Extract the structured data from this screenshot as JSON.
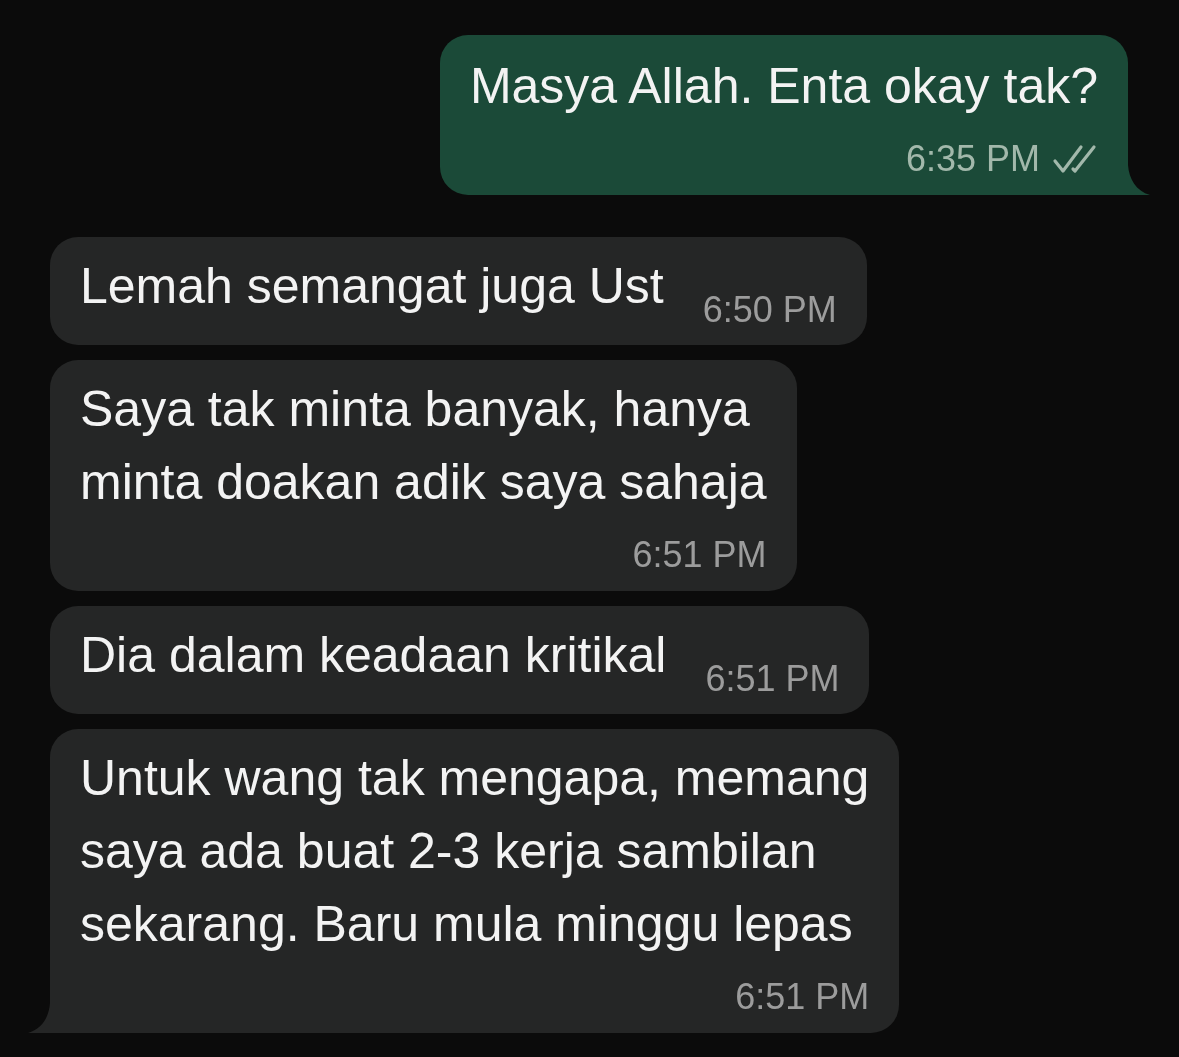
{
  "messages": [
    {
      "kind": "sent",
      "lines": [
        "Masya Allah. Enta okay tak?"
      ],
      "time": "6:35 PM",
      "read": false,
      "tail": true
    },
    {
      "kind": "received",
      "lines": [
        "Lemah semangat juga Ust"
      ],
      "time": "6:50 PM",
      "tail": false
    },
    {
      "kind": "received",
      "lines": [
        "Saya tak minta banyak, hanya",
        "minta doakan adik saya sahaja"
      ],
      "time": "6:51 PM",
      "tail": false
    },
    {
      "kind": "received",
      "lines": [
        "Dia dalam keadaan kritikal"
      ],
      "time": "6:51 PM",
      "tail": false
    },
    {
      "kind": "received",
      "lines": [
        "Untuk wang tak mengapa, memang",
        "saya ada buat 2-3 kerja sambilan",
        "sekarang. Baru mula minggu lepas"
      ],
      "time": "6:51 PM",
      "tail": true
    }
  ]
}
